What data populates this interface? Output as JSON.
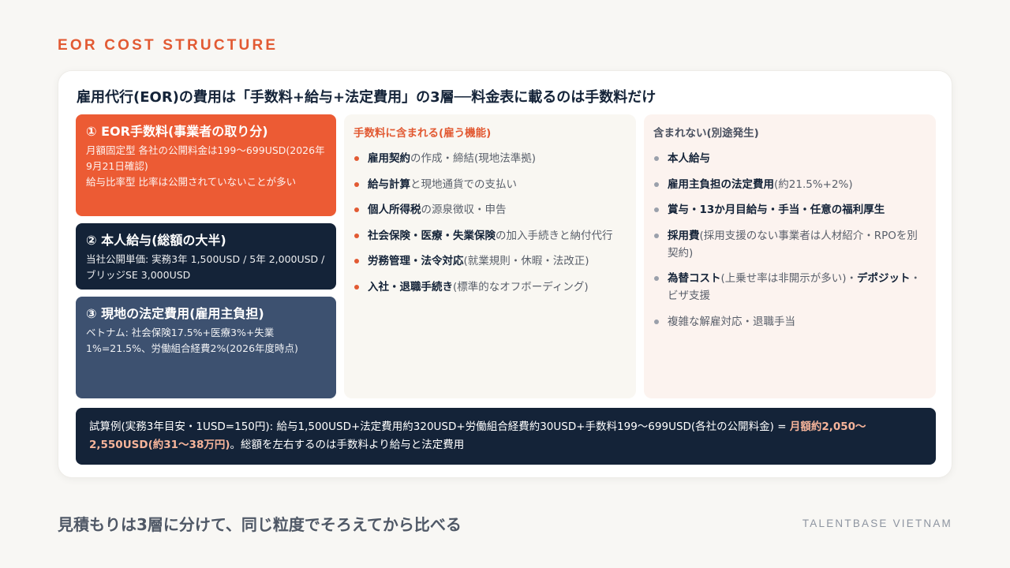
{
  "eyebrow": "EOR COST STRUCTURE",
  "headline": "雇用代行(EOR)の費用は「手数料+給与+法定費用」の3層──料金表に載るのは手数料だけ",
  "layers": [
    {
      "title": "① EOR手数料(事業者の取り分)",
      "lines": [
        "月額固定型 各社の公開料金は199〜699USD(2026年9月21日確認)",
        "給与比率型 比率は公開されていないことが多い"
      ]
    },
    {
      "title": "② 本人給与(総額の大半)",
      "lines": [
        "当社公開単価: 実務3年 1,500USD / 5年 2,000USD / ブリッジSE 3,000USD"
      ]
    },
    {
      "title": "③ 現地の法定費用(雇用主負担)",
      "lines": [
        "ベトナム: 社会保険17.5%+医療3%+失業1%=21.5%、労働組合経費2%(2026年度時点)"
      ]
    }
  ],
  "included": {
    "heading": "手数料に含まれる(雇う機能)",
    "items": [
      {
        "bold": "雇用契約",
        "rest": "の作成・締結(現地法準拠)"
      },
      {
        "bold": "給与計算",
        "rest": "と現地通貨での支払い"
      },
      {
        "bold": "個人所得税",
        "rest": "の源泉徴収・申告"
      },
      {
        "bold": "社会保険・医療・失業保険",
        "rest": "の加入手続きと納付代行"
      },
      {
        "bold": "労務管理・法令対応",
        "rest": "(就業規則・休暇・法改正)"
      },
      {
        "bold": "入社・退職手続き",
        "rest": "(標準的なオフボーディング)"
      }
    ]
  },
  "excluded": {
    "heading": "含まれない(別途発生)",
    "items": [
      {
        "bold": "本人給与",
        "rest": ""
      },
      {
        "bold": "雇用主負担の法定費用",
        "rest": "(約21.5%+2%)"
      },
      {
        "bold": "賞与・13か月目給与・手当・任意の福利厚生",
        "rest": ""
      },
      {
        "bold": "採用費",
        "rest": "(採用支援のない事業者は人材紹介・RPOを別契約)"
      },
      {
        "bold": "為替コスト",
        "rest": "(上乗せ率は非開示が多い)・",
        "bold2": "デポジット",
        "rest2": "・ビザ支援"
      },
      {
        "bold": "",
        "rest": "複雑な解雇対応・退職手当"
      }
    ]
  },
  "example": {
    "prefix": "試算例(実務3年目安・1USD=150円): 給与1,500USD+法定費用約320USD+労働組合経費約30USD+手数料199〜699USD(各社の公開料金) = ",
    "highlight": "月額約2,050〜2,550USD(約31〜38万円)",
    "suffix": "。総額を左右するのは手数料より給与と法定費用"
  },
  "footer": "見積もりは3層に分けて、同じ粒度でそろえてから比べる",
  "brand": "TALENTBASE VIETNAM",
  "colors": {
    "accent": "#e25a33",
    "navy": "#142338",
    "slate": "#3d5170"
  }
}
